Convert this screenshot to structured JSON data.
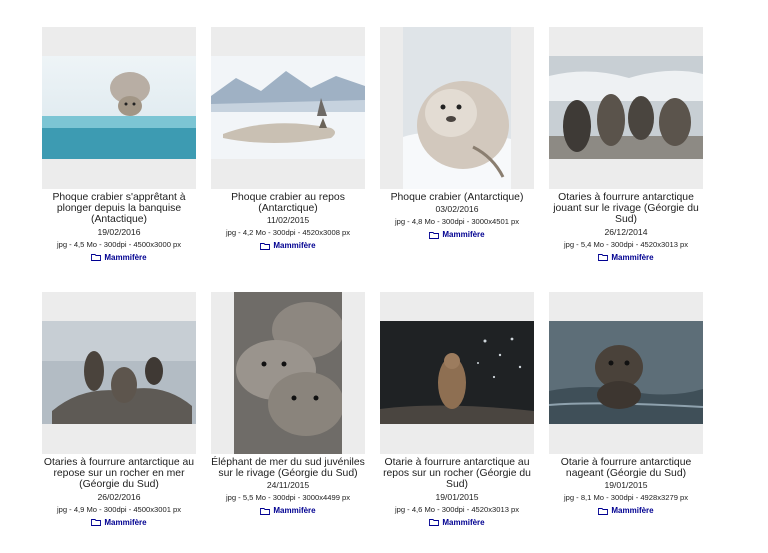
{
  "cards": [
    {
      "title": "Phoque crabier s'apprêtant à plonger depuis la banquise (Antactique)",
      "date": "19/02/2016",
      "meta": "jpg - 4,5 Mo - 300dpi - 4500x3000 px",
      "category": "Mammifère",
      "icon": "folder-icon"
    },
    {
      "title": "Phoque crabier au repos (Antarctique)",
      "date": "11/02/2015",
      "meta": "jpg - 4,2 Mo - 300dpi - 4520x3008 px",
      "category": "Mammifère",
      "icon": "folder-icon"
    },
    {
      "title": "Phoque crabier (Antarctique)",
      "date": "03/02/2016",
      "meta": "jpg - 4,8 Mo - 300dpi - 3000x4501 px",
      "category": "Mammifère",
      "icon": "folder-icon"
    },
    {
      "title": "Otaries à fourrure antarctique jouant sur le rivage (Géorgie du Sud)",
      "date": "26/12/2014",
      "meta": "jpg - 5,4 Mo - 300dpi - 4520x3013 px",
      "category": "Mammifère",
      "icon": "folder-icon"
    },
    {
      "title": "Otaries à fourrure antarctique au repose sur un rocher en mer (Géorgie du Sud)",
      "date": "26/02/2016",
      "meta": "jpg - 4,9 Mo - 300dpi - 4500x3001 px",
      "category": "Mammifère",
      "icon": "folder-icon"
    },
    {
      "title": "Éléphant de mer du sud juvéniles sur le rivage (Géorgie du Sud)",
      "date": "24/11/2015",
      "meta": "jpg - 5,5 Mo - 300dpi - 3000x4499 px",
      "category": "Mammifère",
      "icon": "folder-icon"
    },
    {
      "title": "Otarie à fourrure antarctique au repos sur un rocher (Géorgie du Sud)",
      "date": "19/01/2015",
      "meta": "jpg - 4,6 Mo - 300dpi - 4520x3013 px",
      "category": "Mammifère",
      "icon": "folder-icon"
    },
    {
      "title": "Otarie à fourrure antarctique nageant (Géorgie du Sud)",
      "date": "19/01/2015",
      "meta": "jpg - 8,1 Mo - 300dpi - 4928x3279 px",
      "category": "Mammifère",
      "icon": "folder-icon"
    }
  ],
  "colors": {
    "category_link": "#000091",
    "thumb_bg": "#ececec",
    "text": "#1e1e1e"
  }
}
